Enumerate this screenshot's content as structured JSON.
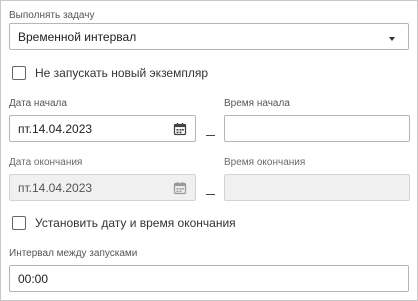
{
  "task": {
    "label": "Выполнять задачу",
    "selected": "Временной интервал"
  },
  "no_new_instance": {
    "label": "Не запускать новый экземпляр",
    "checked": false
  },
  "start": {
    "date_label": "Дата начала",
    "date_value": "пт.14.04.2023",
    "time_label": "Время начала",
    "time_value": ""
  },
  "end": {
    "date_label": "Дата окончания",
    "date_value": "пт.14.04.2023",
    "time_label": "Время окончания",
    "time_value": ""
  },
  "set_end": {
    "label": "Установить дату и время окончания",
    "checked": false
  },
  "interval": {
    "label": "Интервал между запусками",
    "value": "00:00"
  },
  "colors": {
    "border": "#b5b5b5",
    "disabled_bg": "#f0f0f0",
    "text": "#333333"
  },
  "icons": {
    "dropdown": "caret-down-icon",
    "calendar": "calendar-icon"
  }
}
